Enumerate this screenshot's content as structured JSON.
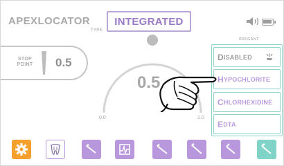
{
  "header": {
    "title": "APEXLOCATOR",
    "type_value": "INTEGRATED",
    "type_label": "TYPE"
  },
  "stop_point": {
    "label_line1": "STOP",
    "label_line2": "POINT",
    "value": "0.5"
  },
  "gauge": {
    "value": "0.5",
    "min_label": "0.0",
    "max_label": "1.0"
  },
  "irrigant": {
    "label": "IRRIGANT",
    "items": [
      {
        "first": "D",
        "rest": "ISABLED"
      },
      {
        "first": "H",
        "rest": "YPOCHLORITE"
      },
      {
        "first": "C",
        "rest": "HLORHEXIDINE"
      },
      {
        "first": "E",
        "rest": "DTA"
      }
    ]
  },
  "toolbar": {
    "icons": [
      "gear-icon",
      "tooth-icon",
      "file-icon",
      "apex-graph-icon",
      "file-icon",
      "file-icon",
      "file-icon",
      "file-icon"
    ]
  },
  "colors": {
    "accent_purple": "#b997dc",
    "teal": "#7fd3c7",
    "orange": "#f5a02d"
  }
}
